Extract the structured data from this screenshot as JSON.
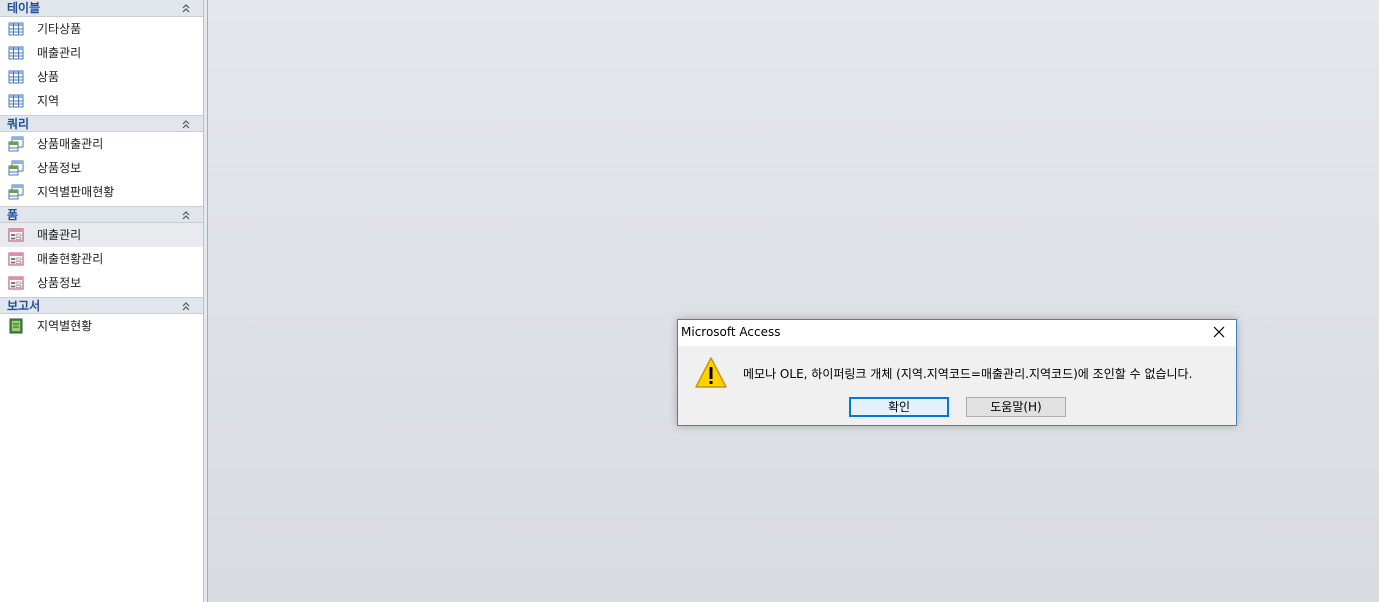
{
  "nav": {
    "groups": [
      {
        "label": "테이블",
        "type": "table",
        "items": [
          {
            "label": "기타상품"
          },
          {
            "label": "매출관리"
          },
          {
            "label": "상품"
          },
          {
            "label": "지역"
          }
        ]
      },
      {
        "label": "쿼리",
        "type": "query",
        "items": [
          {
            "label": "상품매출관리"
          },
          {
            "label": "상품정보"
          },
          {
            "label": "지역별판매현황"
          }
        ]
      },
      {
        "label": "폼",
        "type": "form",
        "items": [
          {
            "label": "매출관리"
          },
          {
            "label": "매출현황관리"
          },
          {
            "label": "상품정보"
          }
        ]
      },
      {
        "label": "보고서",
        "type": "report",
        "items": [
          {
            "label": "지역별현황"
          }
        ]
      }
    ]
  },
  "dialog": {
    "title": "Microsoft Access",
    "message": "메모나 OLE, 하이퍼링크 개체 (지역.지역코드=매출관리.지역코드)에 조인할 수 없습니다.",
    "ok_label": "확인",
    "help_label": "도움말(H)",
    "icon": "warning-icon"
  },
  "colors": {
    "group_header_text": "#1f4e9a",
    "dialog_border": "#3d82c4",
    "default_button_border": "#0078d7"
  }
}
